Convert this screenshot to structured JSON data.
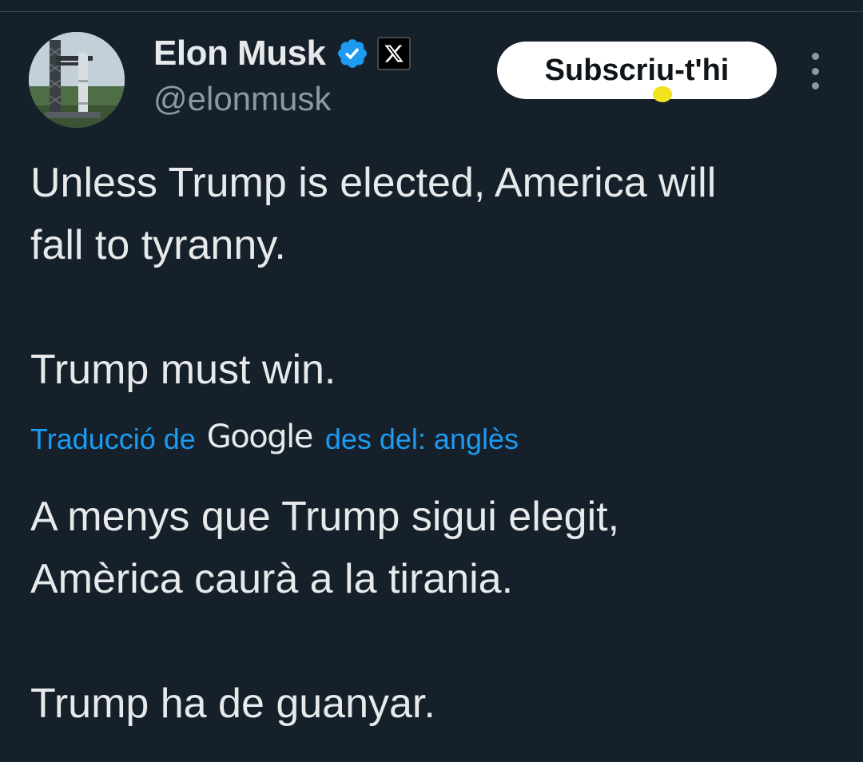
{
  "author": {
    "display_name": "Elon Musk",
    "handle": "@elonmusk",
    "avatar_icon": "rocket-launch-tower-avatar",
    "verified_icon": "verified-badge-icon",
    "affiliation_icon": "x-logo-icon"
  },
  "actions": {
    "subscribe_label": "Subscriu-t'hi",
    "more_icon": "more-vertical-icon"
  },
  "tweet": {
    "text": "Unless Trump is elected, America will\nfall to tyranny.\n\nTrump must win."
  },
  "translation": {
    "prefix": "Traducció de",
    "provider": "Google",
    "source_language": "des del: anglès",
    "text": "A menys que Trump sigui elegit,\nAmèrica caurà a la tirania.\n\nTrump ha de guanyar."
  },
  "colors": {
    "background": "#15202b",
    "primary_text": "#e7e9ea",
    "secondary_text": "#8b98a5",
    "link": "#1d9bf0",
    "verified": "#1d9bf0",
    "button_bg": "#ffffff",
    "touch_indicator": "#f1e21c"
  }
}
